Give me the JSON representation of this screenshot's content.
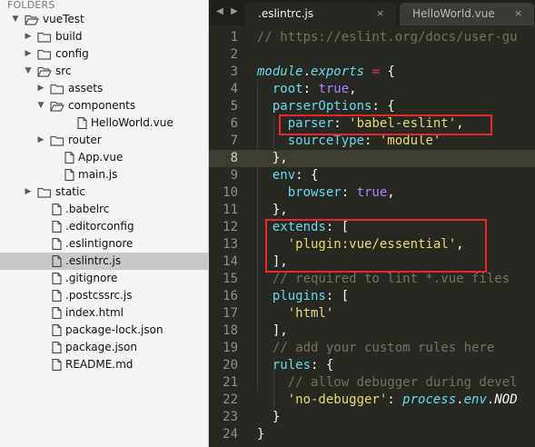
{
  "sidebar": {
    "title": "FOLDERS",
    "items": [
      {
        "label": "vueTest",
        "type": "folder",
        "open": true,
        "depth": 0
      },
      {
        "label": "build",
        "type": "folder",
        "open": false,
        "depth": 1
      },
      {
        "label": "config",
        "type": "folder",
        "open": false,
        "depth": 1
      },
      {
        "label": "src",
        "type": "folder",
        "open": true,
        "depth": 1
      },
      {
        "label": "assets",
        "type": "folder",
        "open": false,
        "depth": 2
      },
      {
        "label": "components",
        "type": "folder",
        "open": true,
        "depth": 2
      },
      {
        "label": "HelloWorld.vue",
        "type": "file",
        "depth": 3
      },
      {
        "label": "router",
        "type": "folder",
        "open": false,
        "depth": 2
      },
      {
        "label": "App.vue",
        "type": "file",
        "depth": 2
      },
      {
        "label": "main.js",
        "type": "file",
        "depth": 2
      },
      {
        "label": "static",
        "type": "folder",
        "open": false,
        "depth": 1
      },
      {
        "label": ".babelrc",
        "type": "file",
        "depth": 1
      },
      {
        "label": ".editorconfig",
        "type": "file",
        "depth": 1
      },
      {
        "label": ".eslintignore",
        "type": "file",
        "depth": 1
      },
      {
        "label": ".eslintrc.js",
        "type": "file",
        "depth": 1,
        "selected": true
      },
      {
        "label": ".gitignore",
        "type": "file",
        "depth": 1
      },
      {
        "label": ".postcssrc.js",
        "type": "file",
        "depth": 1
      },
      {
        "label": "index.html",
        "type": "file",
        "depth": 1
      },
      {
        "label": "package-lock.json",
        "type": "file",
        "depth": 1
      },
      {
        "label": "package.json",
        "type": "file",
        "depth": 1
      },
      {
        "label": "README.md",
        "type": "file",
        "depth": 1
      }
    ]
  },
  "tabs": {
    "prev_icon": "chevron-left-icon",
    "next_icon": "chevron-right-icon",
    "items": [
      {
        "label": ".eslintrc.js",
        "active": true,
        "close": "×"
      },
      {
        "label": "HelloWorld.vue",
        "active": false,
        "close": "×"
      }
    ]
  },
  "editor": {
    "current_line": 8,
    "lines": [
      {
        "num": "1",
        "tokens": [
          {
            "t": "// https://eslint.org/docs/user-gu",
            "c": "c"
          }
        ]
      },
      {
        "num": "2",
        "tokens": []
      },
      {
        "num": "3",
        "tokens": [
          {
            "t": "module",
            "c": "k"
          },
          {
            "t": ".",
            "c": "w"
          },
          {
            "t": "exports",
            "c": "k"
          },
          {
            "t": " ",
            "c": "w"
          },
          {
            "t": "=",
            "c": "o"
          },
          {
            "t": " {",
            "c": "w"
          }
        ]
      },
      {
        "num": "4",
        "tokens": [
          {
            "t": "  root",
            "c": "p"
          },
          {
            "t": ": ",
            "c": "w"
          },
          {
            "t": "true",
            "c": "n"
          },
          {
            "t": ",",
            "c": "w"
          }
        ]
      },
      {
        "num": "5",
        "tokens": [
          {
            "t": "  parserOptions",
            "c": "p"
          },
          {
            "t": ": {",
            "c": "w"
          }
        ]
      },
      {
        "num": "6",
        "tokens": [
          {
            "t": "    parser",
            "c": "p"
          },
          {
            "t": ": ",
            "c": "w"
          },
          {
            "t": "'babel-eslint'",
            "c": "s"
          },
          {
            "t": ",",
            "c": "w"
          }
        ]
      },
      {
        "num": "7",
        "tokens": [
          {
            "t": "    sourceType",
            "c": "p"
          },
          {
            "t": ": ",
            "c": "w"
          },
          {
            "t": "'module'",
            "c": "s"
          }
        ]
      },
      {
        "num": "8",
        "tokens": [
          {
            "t": "  },",
            "c": "w"
          }
        ]
      },
      {
        "num": "9",
        "tokens": [
          {
            "t": "  env",
            "c": "p"
          },
          {
            "t": ": {",
            "c": "w"
          }
        ]
      },
      {
        "num": "10",
        "tokens": [
          {
            "t": "    browser",
            "c": "p"
          },
          {
            "t": ": ",
            "c": "w"
          },
          {
            "t": "true",
            "c": "n"
          },
          {
            "t": ",",
            "c": "w"
          }
        ]
      },
      {
        "num": "11",
        "tokens": [
          {
            "t": "  },",
            "c": "w"
          }
        ]
      },
      {
        "num": "12",
        "tokens": [
          {
            "t": "  extends",
            "c": "p"
          },
          {
            "t": ": [",
            "c": "w"
          }
        ]
      },
      {
        "num": "13",
        "tokens": [
          {
            "t": "    ",
            "c": "w"
          },
          {
            "t": "'plugin:vue/essential'",
            "c": "s"
          },
          {
            "t": ",",
            "c": "w"
          }
        ]
      },
      {
        "num": "14",
        "tokens": [
          {
            "t": "  ],",
            "c": "w"
          }
        ]
      },
      {
        "num": "15",
        "tokens": [
          {
            "t": "  // required to lint *.vue files",
            "c": "c"
          }
        ]
      },
      {
        "num": "16",
        "tokens": [
          {
            "t": "  plugins",
            "c": "p"
          },
          {
            "t": ": [",
            "c": "w"
          }
        ]
      },
      {
        "num": "17",
        "tokens": [
          {
            "t": "    ",
            "c": "w"
          },
          {
            "t": "'html'",
            "c": "s"
          }
        ]
      },
      {
        "num": "18",
        "tokens": [
          {
            "t": "  ],",
            "c": "w"
          }
        ]
      },
      {
        "num": "19",
        "tokens": [
          {
            "t": "  // add your custom rules here",
            "c": "c"
          }
        ]
      },
      {
        "num": "20",
        "tokens": [
          {
            "t": "  rules",
            "c": "p"
          },
          {
            "t": ": {",
            "c": "w"
          }
        ]
      },
      {
        "num": "21",
        "tokens": [
          {
            "t": "    // allow debugger during devel",
            "c": "c"
          }
        ]
      },
      {
        "num": "22",
        "tokens": [
          {
            "t": "    ",
            "c": "w"
          },
          {
            "t": "'no-debugger'",
            "c": "s"
          },
          {
            "t": ": ",
            "c": "w"
          },
          {
            "t": "process",
            "c": "k"
          },
          {
            "t": ".",
            "c": "w"
          },
          {
            "t": "env",
            "c": "k"
          },
          {
            "t": ".",
            "c": "w"
          },
          {
            "t": "NOD",
            "c": "pk"
          }
        ]
      },
      {
        "num": "23",
        "tokens": [
          {
            "t": "  }",
            "c": "w"
          }
        ]
      },
      {
        "num": "24",
        "tokens": [
          {
            "t": "}",
            "c": "w"
          }
        ]
      }
    ]
  },
  "colors": {
    "annotation_box": "#e8262a",
    "folder_icon": "#555555",
    "editor_bg": "#272822"
  }
}
